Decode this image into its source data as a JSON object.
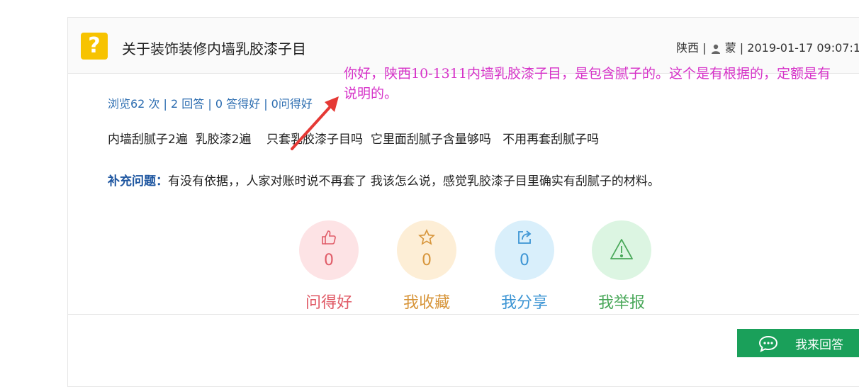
{
  "question": {
    "title": "关于装饰装修内墙乳胶漆子目",
    "region": "陕西",
    "separator": "|",
    "user": "蒙",
    "datetime": "2019-01-17 09:07:1",
    "stats": "浏览62 次 | 2 回答 | 0 答得好 | 0问得好",
    "body": "内墙刮腻子2遍  乳胶漆2遍    只套乳胶漆子目吗  它里面刮腻子含量够吗   不用再套刮腻子吗",
    "supplement_label": "补充问题：",
    "supplement_text": "有没有依据，，人家对账时说不再套了  我该怎么说，感觉乳胶漆子目里确实有刮腻子的材料。"
  },
  "actions": [
    {
      "icon": "thumbs-up-icon",
      "count": "0",
      "label": "问得好",
      "color": "#e05a66"
    },
    {
      "icon": "star-icon",
      "count": "0",
      "label": "我收藏",
      "color": "#d7953a"
    },
    {
      "icon": "share-icon",
      "count": "0",
      "label": "我分享",
      "color": "#3d95d4"
    },
    {
      "icon": "warning-icon",
      "count": "",
      "label": "我举报",
      "color": "#4aa85a"
    }
  ],
  "answer_button": {
    "label": "我来回答",
    "icon": "chat-icon",
    "color": "#1aa05a"
  },
  "annotation": {
    "text": "你好，陕西10-1311内墙乳胶漆子目，是包含腻子的。这个是有根据的，定额是有说明的。",
    "color": "#d632c8",
    "arrow_color": "#e53935"
  }
}
